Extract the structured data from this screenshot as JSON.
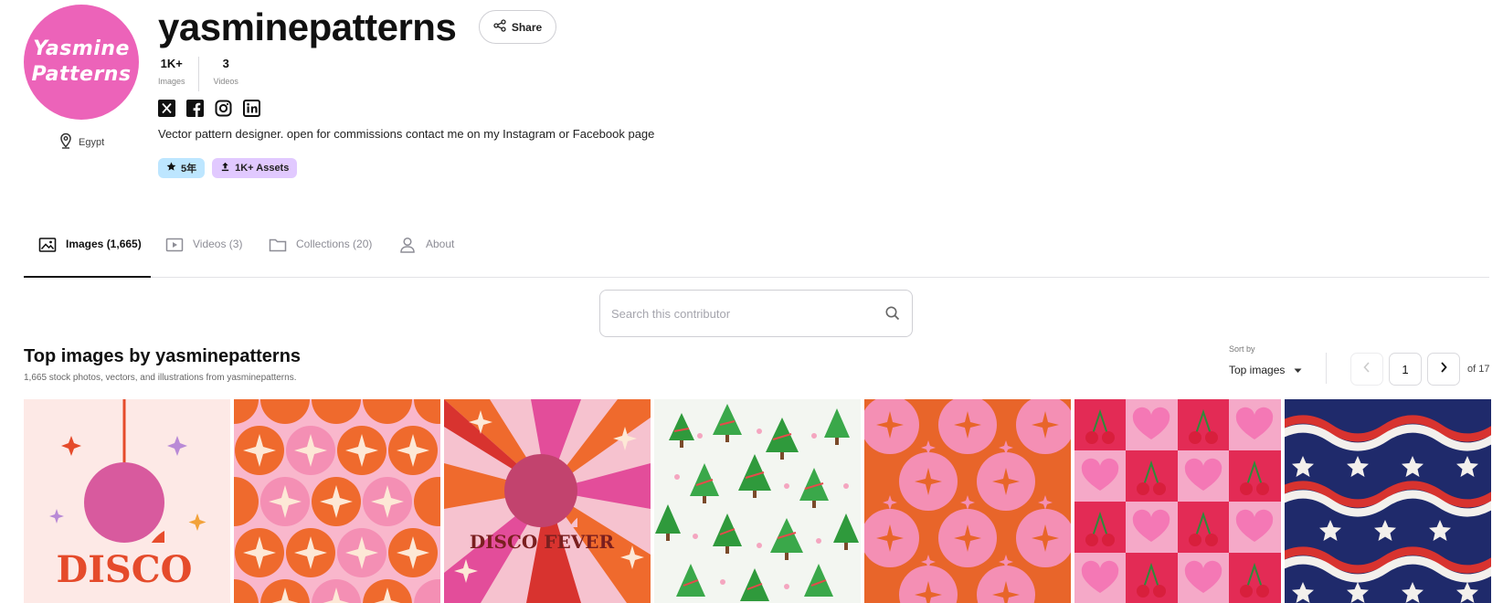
{
  "profile": {
    "avatar_line1": "Yasmine",
    "avatar_line2": "Patterns",
    "username": "yasminepatterns",
    "location": "Egypt",
    "share_label": "Share",
    "stats": [
      {
        "value": "1K+",
        "label": "Images"
      },
      {
        "value": "3",
        "label": "Videos"
      }
    ],
    "socials": [
      "x-icon",
      "facebook-icon",
      "instagram-icon",
      "linkedin-icon"
    ],
    "bio": "Vector pattern designer. open for commissions contact me on my Instagram or Facebook page",
    "badges": [
      {
        "label": "5年",
        "icon": "star-icon",
        "color": "#bde6ff"
      },
      {
        "label": "1K+ Assets",
        "icon": "upload-icon",
        "color": "#e1c9ff"
      }
    ]
  },
  "tabs": [
    {
      "label": "Images (1,665)",
      "icon": "image-icon",
      "active": true
    },
    {
      "label": "Videos (3)",
      "icon": "video-icon",
      "active": false
    },
    {
      "label": "Collections (20)",
      "icon": "folder-icon",
      "active": false
    },
    {
      "label": "About",
      "icon": "person-icon",
      "active": false
    }
  ],
  "search": {
    "placeholder": "Search this contributor",
    "value": ""
  },
  "section": {
    "title": "Top images by yasminepatterns",
    "subtitle": "1,665 stock photos, vectors, and illustrations from yasminepatterns."
  },
  "sort": {
    "label": "Sort by",
    "value": "Top images"
  },
  "pagination": {
    "current": "1",
    "of_label": "of 17"
  },
  "images": [
    {
      "name": "disco-ball-thumbnail",
      "text": "DISCO"
    },
    {
      "name": "orange-pink-star-pattern-thumbnail",
      "text": ""
    },
    {
      "name": "disco-fever-thumbnail",
      "text": "DISCO FEVER"
    },
    {
      "name": "christmas-trees-pattern-thumbnail",
      "text": ""
    },
    {
      "name": "orange-pink-sparkle-pattern-thumbnail",
      "text": ""
    },
    {
      "name": "cherry-heart-checker-thumbnail",
      "text": ""
    },
    {
      "name": "stars-and-stripes-wave-thumbnail",
      "text": ""
    }
  ],
  "colors": {
    "avatar_bg": "#ec63b9",
    "badge_years": "#bde6ff",
    "badge_assets": "#e1c9ff",
    "accent": "#111111"
  }
}
